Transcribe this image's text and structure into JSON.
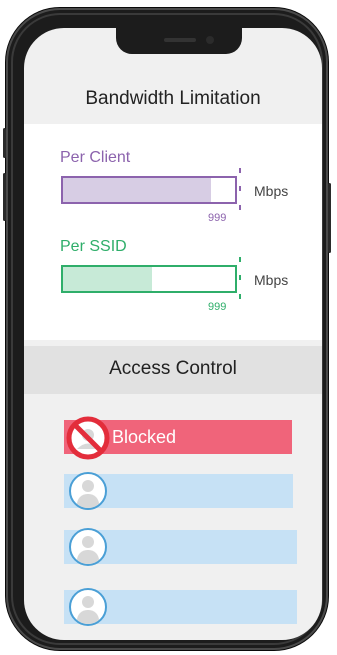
{
  "bandwidth": {
    "title": "Bandwidth Limitation",
    "per_client": {
      "label": "Per Client",
      "unit": "Mbps",
      "max": "999",
      "fill_fraction": 0.86
    },
    "per_ssid": {
      "label": "Per SSID",
      "unit": "Mbps",
      "max": "999",
      "fill_fraction": 0.52
    }
  },
  "access_control": {
    "title": "Access Control",
    "rows": [
      {
        "label": "Blocked",
        "status": "blocked"
      },
      {
        "label": "",
        "status": "allowed"
      },
      {
        "label": "",
        "status": "allowed"
      },
      {
        "label": "",
        "status": "allowed"
      }
    ]
  },
  "colors": {
    "client_purple": "#8c63ad",
    "client_fill": "#d7cde4",
    "ssid_green": "#2fae6a",
    "ssid_fill": "#c7ead7",
    "blocked_red": "#f0647a",
    "block_icon_red": "#e32d3b",
    "row_blue": "#c6e1f5",
    "avatar_blue": "#4a9fd6"
  },
  "icons": [
    "no-entry-icon",
    "user-avatar-icon"
  ]
}
